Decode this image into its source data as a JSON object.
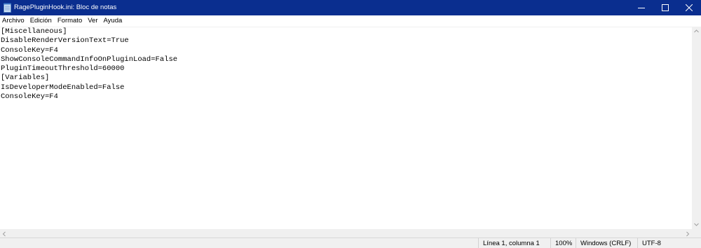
{
  "window": {
    "title": "RagePluginHook.ini: Bloc de notas",
    "icon": "notepad-icon",
    "controls": [
      "minimize-icon",
      "maximize-icon",
      "close-icon"
    ]
  },
  "menu": {
    "items": [
      "Archivo",
      "Edición",
      "Formato",
      "Ver",
      "Ayuda"
    ]
  },
  "editor": {
    "lines": [
      "[Miscellaneous]",
      "DisableRenderVersionText=True",
      "ConsoleKey=F4",
      "ShowConsoleCommandInfoOnPluginLoad=False",
      "PluginTimeoutThreshold=60000",
      "[Variables]",
      "IsDeveloperModeEnabled=False",
      "ConsoleKey=F4"
    ]
  },
  "status": {
    "position": "Línea 1, columna 1",
    "zoom": "100%",
    "line_ending": "Windows (CRLF)",
    "encoding": "UTF-8"
  },
  "colors": {
    "titlebar": "#0a2e8f",
    "background": "#ffffff",
    "statusbar": "#f0f0f0"
  }
}
